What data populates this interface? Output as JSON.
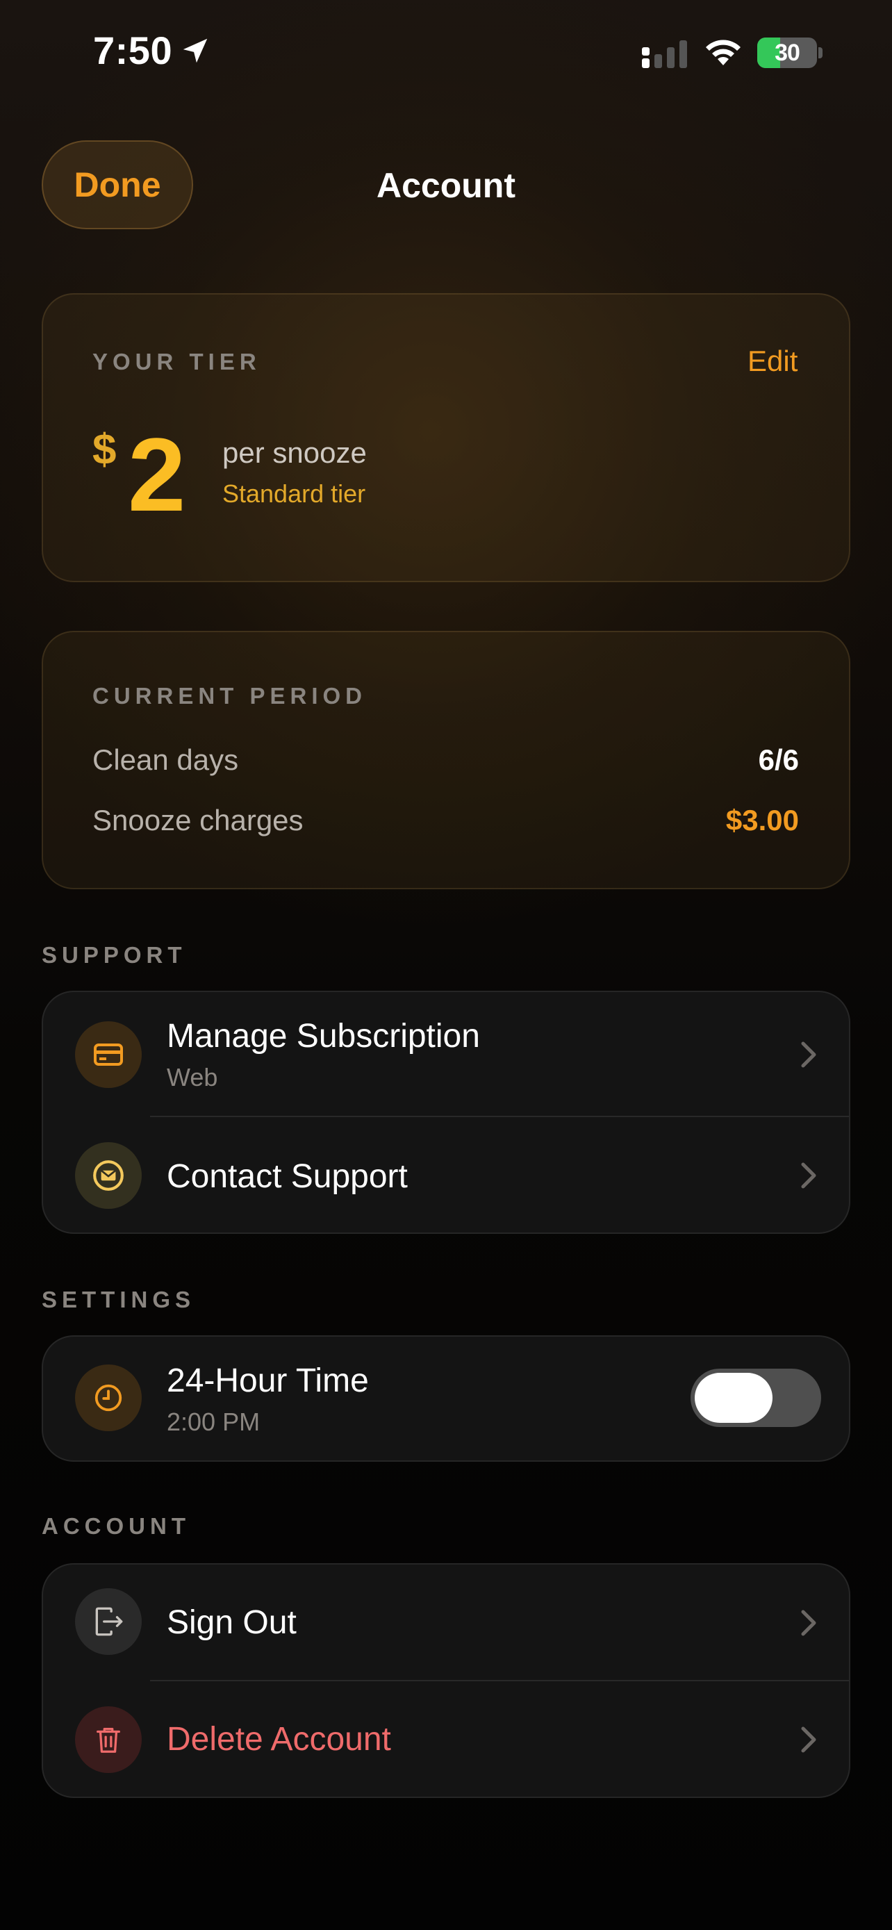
{
  "status_bar": {
    "time": "7:50",
    "battery": "30"
  },
  "nav": {
    "done_label": "Done",
    "title": "Account"
  },
  "tier": {
    "section_label": "YOUR TIER",
    "edit_label": "Edit",
    "currency_symbol": "$",
    "amount": "2",
    "unit": "per snooze",
    "tier_name": "Standard tier"
  },
  "period": {
    "section_label": "CURRENT PERIOD",
    "rows": [
      {
        "label": "Clean days",
        "value": "6/6",
        "color": "#ffffff"
      },
      {
        "label": "Snooze charges",
        "value": "$3.00",
        "color": "#f29b21"
      }
    ]
  },
  "support": {
    "section_label": "SUPPORT",
    "items": [
      {
        "title": "Manage Subscription",
        "subtitle": "Web",
        "icon": "credit-card-icon"
      },
      {
        "title": "Contact Support",
        "icon": "mail-icon"
      }
    ]
  },
  "settings": {
    "section_label": "SETTINGS",
    "items": [
      {
        "title": "24-Hour Time",
        "subtitle": "2:00 PM",
        "icon": "clock-icon",
        "toggle_on": false
      }
    ]
  },
  "account": {
    "section_label": "ACCOUNT",
    "items": [
      {
        "title": "Sign Out",
        "icon": "sign-out-icon"
      },
      {
        "title": "Delete Account",
        "icon": "trash-icon",
        "color": "#ef6b6b"
      }
    ]
  },
  "colors": {
    "accent": "#f29b21",
    "gold": "#fbbd24",
    "danger": "#ef6b6b",
    "background": "#000000"
  }
}
